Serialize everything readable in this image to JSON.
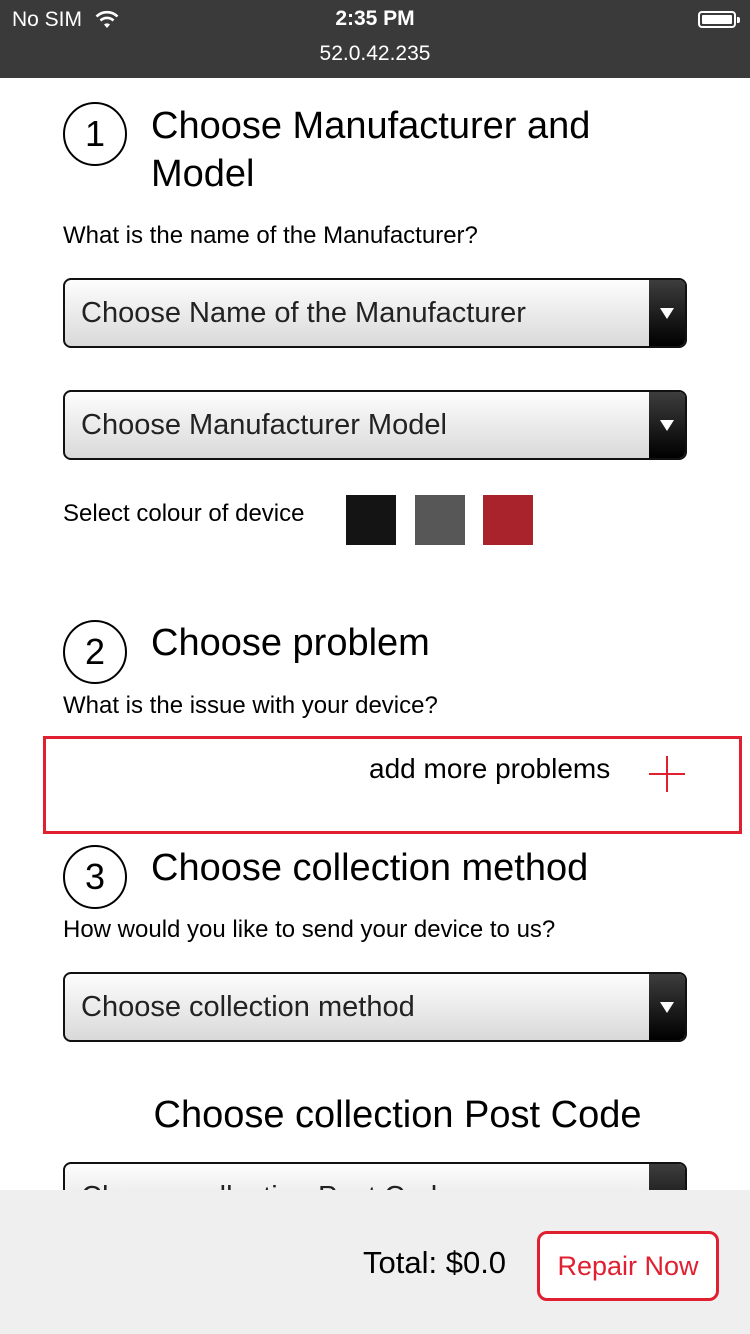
{
  "status_bar": {
    "carrier": "No SIM",
    "time": "2:35 PM",
    "url": "52.0.42.235"
  },
  "step1": {
    "number": "1",
    "title_line1": "Choose Manufacturer and",
    "title_line2": "Model",
    "question": "What is the name of the Manufacturer?",
    "manufacturer_select": "Choose Name of the Manufacturer",
    "model_select": "Choose Manufacturer Model",
    "colour_label": "Select colour of device",
    "colours": [
      "#141414",
      "#575757",
      "#a8232c"
    ]
  },
  "step2": {
    "number": "2",
    "title": "Choose problem",
    "question": "What is the issue with your device?",
    "add_problems": "add more problems"
  },
  "step3": {
    "number": "3",
    "title": "Choose collection method",
    "question": "How would you like to send your device to us?",
    "method_select": "Choose collection method",
    "postcode_title": "Choose collection Post Code",
    "postcode_select": "Choose collection Post Code"
  },
  "footer": {
    "total": "Total: $0.0",
    "repair_button": "Repair Now"
  },
  "colors": {
    "accent": "#e02030",
    "status_bar": "#3a3a3a",
    "footer_bg": "#efefef"
  }
}
